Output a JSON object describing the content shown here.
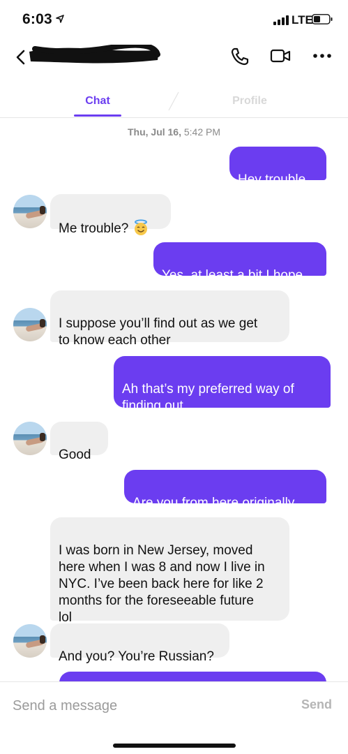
{
  "status_bar": {
    "time": "6:03",
    "network": "LTE"
  },
  "tabs": [
    {
      "label": "Chat",
      "active": true
    },
    {
      "label": "Profile",
      "active": false
    }
  ],
  "date_stamp": {
    "day": "Thu, Jul 16,",
    "time": "5:42 PM"
  },
  "messages": [
    {
      "direction": "outgoing",
      "text": "Hey trouble"
    },
    {
      "direction": "incoming",
      "text": "Me trouble?",
      "emoji": "smiling-face-with-halo"
    },
    {
      "direction": "outgoing",
      "text": "Yes, at least a bit I hope"
    },
    {
      "direction": "incoming",
      "text": "I suppose you’ll find out as we get\nto know each other"
    },
    {
      "direction": "outgoing",
      "text": "Ah that’s my preferred way of\nfinding out"
    },
    {
      "direction": "incoming",
      "text": "Good"
    },
    {
      "direction": "outgoing",
      "text": "Are you from here originally"
    },
    {
      "direction": "incoming",
      "text": "I was born in New Jersey, moved\nhere when I was 8 and now I live in\nNYC. I’ve been back here for like 2\nmonths for the foreseeable future\nlol"
    },
    {
      "direction": "incoming",
      "text": "And you? You’re Russian?"
    },
    {
      "direction": "outgoing",
      "text": ""
    }
  ],
  "composer": {
    "placeholder": "Send a message",
    "send_label": "Send"
  },
  "icons": [
    "location-arrow-icon",
    "signal-icon",
    "battery-icon",
    "back-chevron-icon",
    "phone-icon",
    "video-camera-icon",
    "more-icon"
  ],
  "colors": {
    "accent": "#6b3df0",
    "incoming_bubble": "#efefef",
    "inactive_tab": "#d8d8d8"
  }
}
